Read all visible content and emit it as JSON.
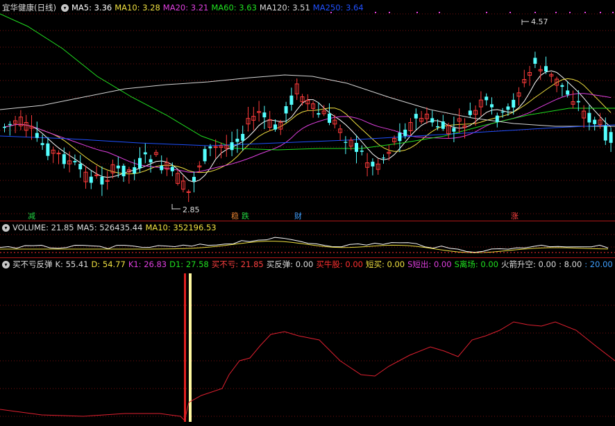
{
  "price_panel": {
    "stock_name": "宜华健康(日线)",
    "ma": [
      {
        "label": "MA5: 3.36",
        "color": "#ffffff"
      },
      {
        "label": "MA10: 3.28",
        "color": "#f0e040"
      },
      {
        "label": "MA20: 3.21",
        "color": "#e040e0"
      },
      {
        "label": "MA60: 3.63",
        "color": "#20e020"
      },
      {
        "label": "MA120: 3.51",
        "color": "#d8d8d8"
      },
      {
        "label": "MA250: 3.64",
        "color": "#2050ff"
      }
    ],
    "high_label": "4.57",
    "low_label": "2.85",
    "markers": [
      {
        "text": "减",
        "color": "#20d040"
      },
      {
        "text": "稳",
        "color": "#e08030"
      },
      {
        "text": "跌",
        "color": "#20d040"
      },
      {
        "text": "财",
        "color": "#40a0ff"
      },
      {
        "text": "涨",
        "color": "#ff4040"
      }
    ]
  },
  "volume_panel": {
    "items": [
      {
        "label": "VOLUME: 21.85",
        "color": "#dddddd"
      },
      {
        "label": "MA5: 526435.44",
        "color": "#dddddd"
      },
      {
        "label": "MA10: 352196.53",
        "color": "#f0e040"
      }
    ]
  },
  "indicator_panel": {
    "name": "买不亏反弹",
    "items": [
      {
        "label": "K: 55.41",
        "color": "#dddddd"
      },
      {
        "label": "D: 54.77",
        "color": "#f0e040"
      },
      {
        "label": "K1: 26.83",
        "color": "#e040e0"
      },
      {
        "label": "D1: 27.58",
        "color": "#20e020"
      },
      {
        "label": "买不亏: 21.85",
        "color": "#ff4040"
      },
      {
        "label": "买反弹: 0.00",
        "color": "#dddddd"
      },
      {
        "label": "买牛股: 0.00",
        "color": "#ff3030"
      },
      {
        "label": "短买: 0.00",
        "color": "#f0e040"
      },
      {
        "label": "S短出: 0.00",
        "color": "#e040e0"
      },
      {
        "label": "S离场: 0.00",
        "color": "#20e020"
      },
      {
        "label": "火箭升空: 0.00",
        "color": "#dddddd"
      },
      {
        "label": ": 8.00",
        "color": "#dddddd"
      },
      {
        "label": ": 20.00",
        "color": "#40a0ff"
      }
    ]
  },
  "colors": {
    "up_candle": "#ff3b3b",
    "down_candle": "#54ffff",
    "grid": "#7a1010",
    "separator": "#b01818"
  }
}
